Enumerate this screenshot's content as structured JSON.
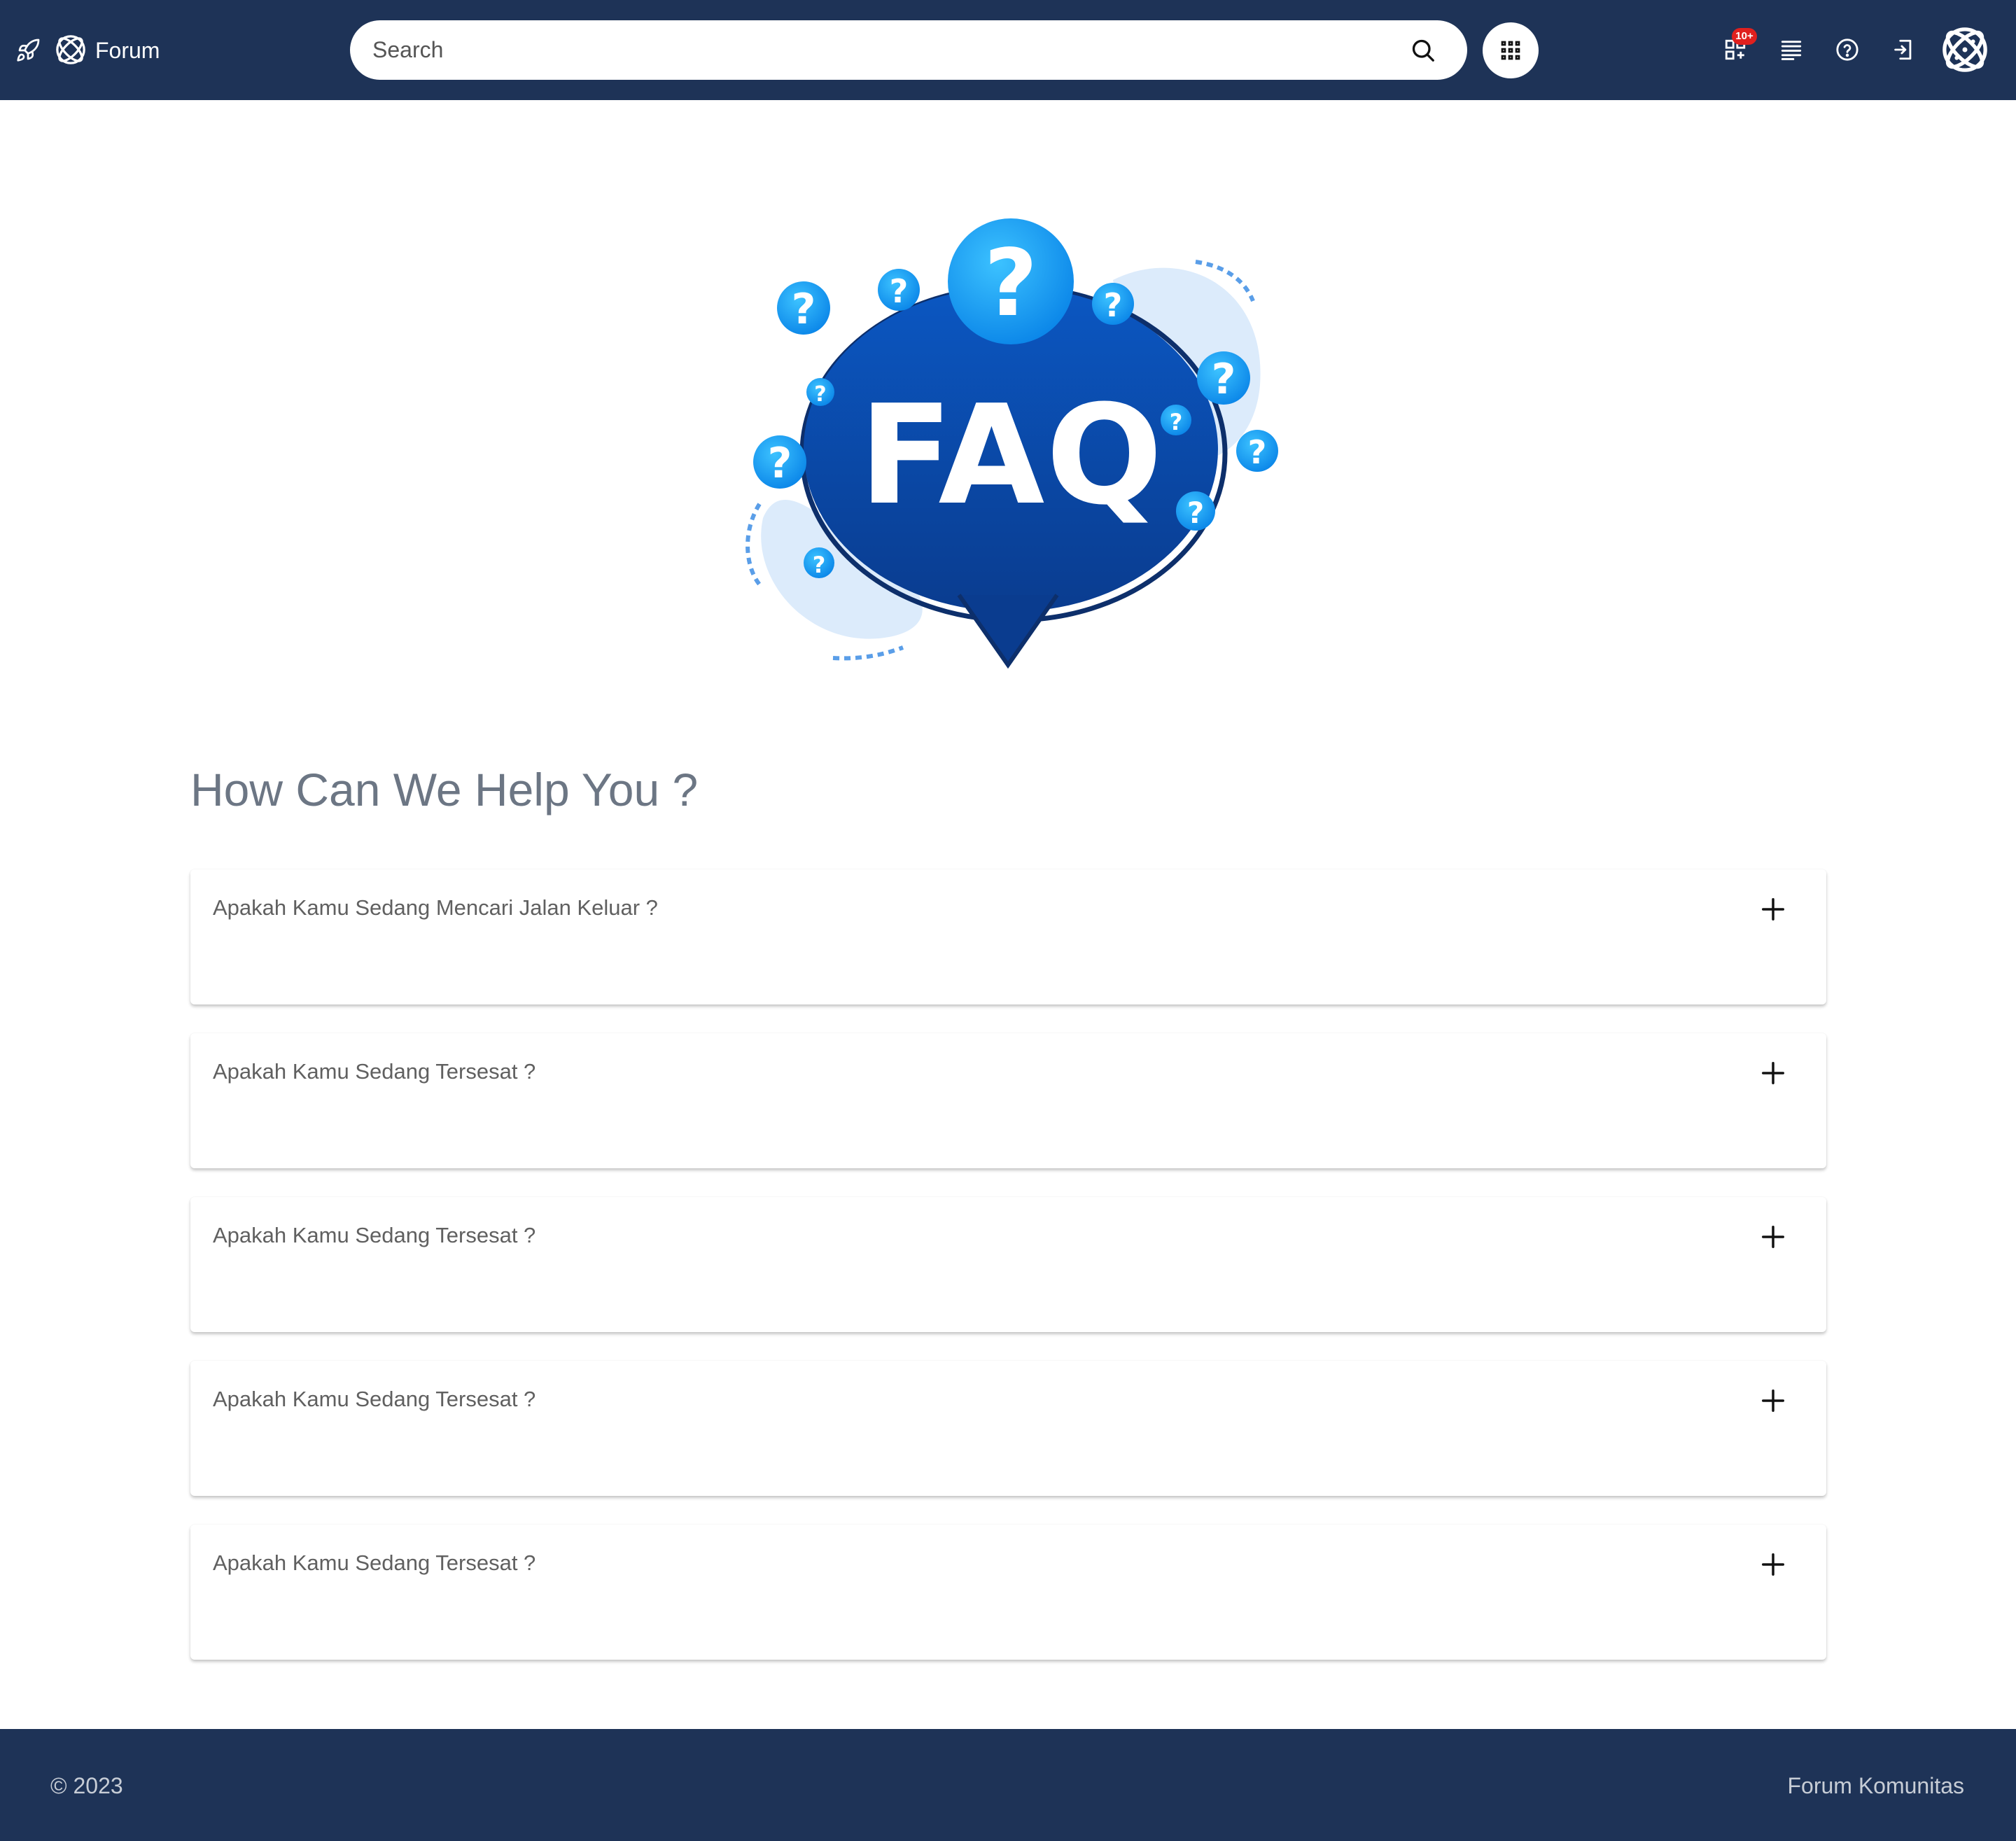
{
  "colors": {
    "header_bg": "#1e3357",
    "footer_bg": "#1e3357",
    "badge_bg": "#e0201e",
    "heading_text": "#6c7684",
    "faq_blue": "#0a4aa8",
    "faq_light_blue": "#1ca3f5"
  },
  "header": {
    "rocket_icon": "rocket-icon",
    "logo_icon": "forum-logo-icon",
    "brand_name": "Forum",
    "search": {
      "placeholder": "Search",
      "value": "",
      "icon": "search-icon"
    },
    "apps_icon": "grid-apps-icon",
    "nav_icons": [
      {
        "name": "notifications-icon",
        "badge": "10+"
      },
      {
        "name": "list-icon"
      },
      {
        "name": "help-icon"
      },
      {
        "name": "login-icon"
      }
    ],
    "profile_icon": "forum-logo-icon"
  },
  "hero": {
    "image_text": "FAQ"
  },
  "main": {
    "heading": "How Can We Help You ?",
    "faq_items": [
      {
        "question": "Apakah Kamu Sedang Mencari Jalan Keluar ?",
        "toggle": "+"
      },
      {
        "question": "Apakah Kamu Sedang Tersesat ?",
        "toggle": "+"
      },
      {
        "question": "Apakah Kamu Sedang Tersesat ?",
        "toggle": "+"
      },
      {
        "question": "Apakah Kamu Sedang Tersesat ?",
        "toggle": "+"
      },
      {
        "question": "Apakah Kamu Sedang Tersesat ?",
        "toggle": "+"
      }
    ]
  },
  "footer": {
    "copyright": "© 2023",
    "brand": "Forum Komunitas"
  }
}
